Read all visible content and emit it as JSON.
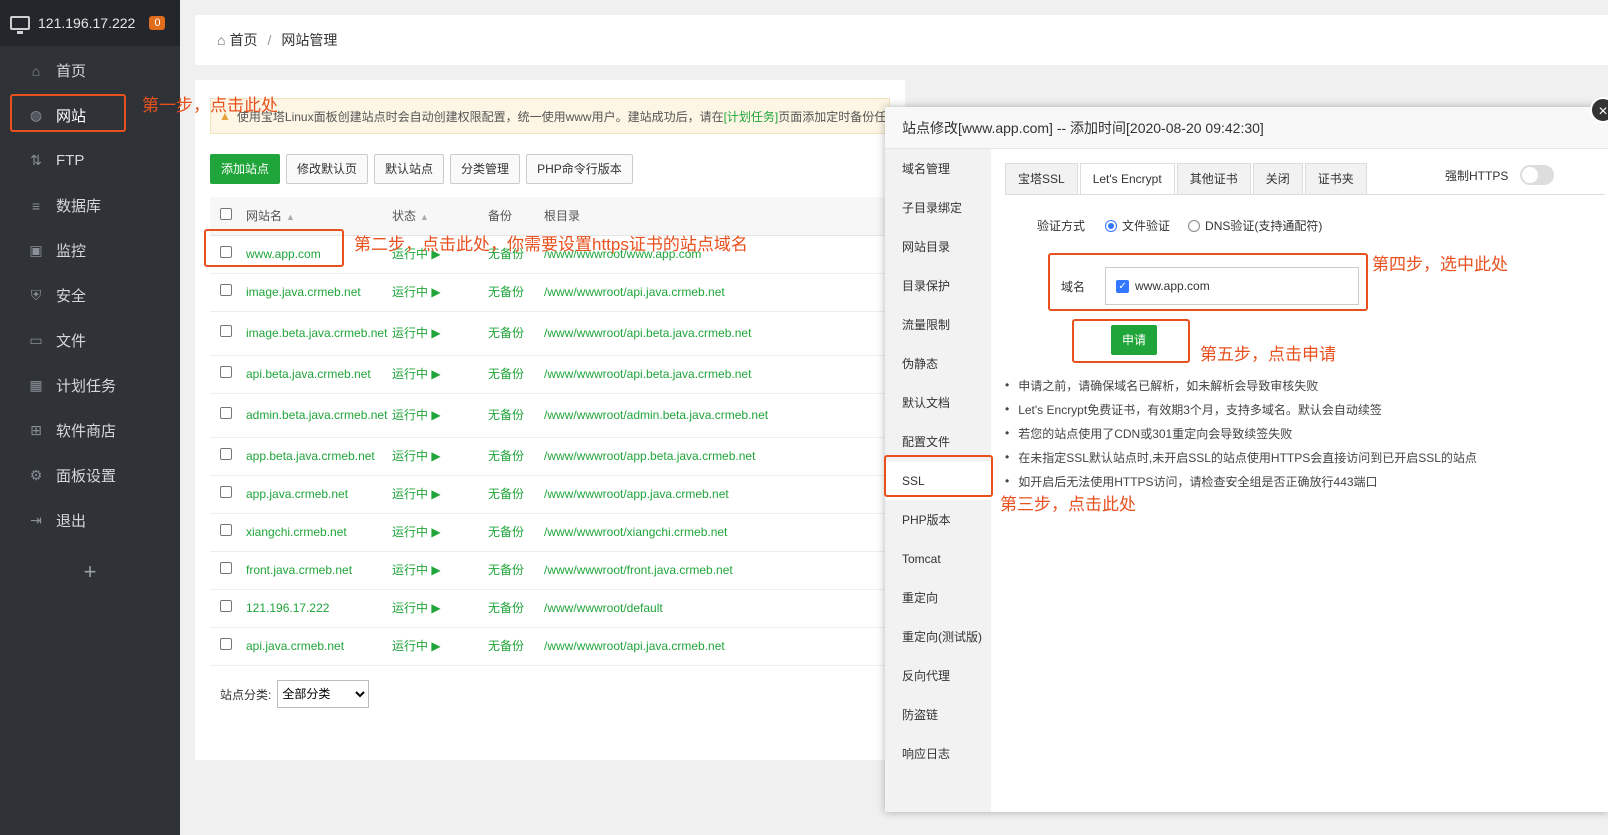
{
  "sidebar": {
    "server_ip": "121.196.17.222",
    "badge": "0",
    "items": [
      {
        "label": "首页",
        "icon": "home-icon"
      },
      {
        "label": "网站",
        "icon": "globe-icon"
      },
      {
        "label": "FTP",
        "icon": "ftp-icon"
      },
      {
        "label": "数据库",
        "icon": "database-icon"
      },
      {
        "label": "监控",
        "icon": "monitor-icon"
      },
      {
        "label": "安全",
        "icon": "shield-icon"
      },
      {
        "label": "文件",
        "icon": "folder-icon"
      },
      {
        "label": "计划任务",
        "icon": "calendar-icon"
      },
      {
        "label": "软件商店",
        "icon": "apps-icon"
      },
      {
        "label": "面板设置",
        "icon": "gear-icon"
      },
      {
        "label": "退出",
        "icon": "logout-icon"
      }
    ],
    "add": "+"
  },
  "breadcrumb": {
    "home": "首页",
    "sep": "/",
    "current": "网站管理"
  },
  "notice": {
    "text_a": "使用宝塔Linux面板创建站点时会自动创建权限配置，统一使用www用户。建站成功后，请在",
    "link": "[计划任务]",
    "text_b": "页面添加定时备份任务"
  },
  "toolbar": {
    "add_site": "添加站点",
    "edit_default_page": "修改默认页",
    "default_site": "默认站点",
    "category": "分类管理",
    "php_cli": "PHP命令行版本"
  },
  "table": {
    "headers": {
      "name": "网站名",
      "status": "状态",
      "backup": "备份",
      "root": "根目录"
    },
    "rows": [
      {
        "name": "www.app.com",
        "status": "运行中 ▶",
        "backup": "无备份",
        "root": "/www/wwwroot/www.app.com"
      },
      {
        "name": "image.java.crmeb.net",
        "status": "运行中 ▶",
        "backup": "无备份",
        "root": "/www/wwwroot/api.java.crmeb.net"
      },
      {
        "name": "image.beta.java.crmeb.net",
        "status": "运行中 ▶",
        "backup": "无备份",
        "root": "/www/wwwroot/api.beta.java.crmeb.net"
      },
      {
        "name": "api.beta.java.crmeb.net",
        "status": "运行中 ▶",
        "backup": "无备份",
        "root": "/www/wwwroot/api.beta.java.crmeb.net"
      },
      {
        "name": "admin.beta.java.crmeb.net",
        "status": "运行中 ▶",
        "backup": "无备份",
        "root": "/www/wwwroot/admin.beta.java.crmeb.net"
      },
      {
        "name": "app.beta.java.crmeb.net",
        "status": "运行中 ▶",
        "backup": "无备份",
        "root": "/www/wwwroot/app.beta.java.crmeb.net"
      },
      {
        "name": "app.java.crmeb.net",
        "status": "运行中 ▶",
        "backup": "无备份",
        "root": "/www/wwwroot/app.java.crmeb.net"
      },
      {
        "name": "xiangchi.crmeb.net",
        "status": "运行中 ▶",
        "backup": "无备份",
        "root": "/www/wwwroot/xiangchi.crmeb.net"
      },
      {
        "name": "front.java.crmeb.net",
        "status": "运行中 ▶",
        "backup": "无备份",
        "root": "/www/wwwroot/front.java.crmeb.net"
      },
      {
        "name": "121.196.17.222",
        "status": "运行中 ▶",
        "backup": "无备份",
        "root": "/www/wwwroot/default"
      },
      {
        "name": "api.java.crmeb.net",
        "status": "运行中 ▶",
        "backup": "无备份",
        "root": "/www/wwwroot/api.java.crmeb.net"
      }
    ]
  },
  "category": {
    "label": "站点分类:",
    "selected": "全部分类"
  },
  "modal": {
    "title": "站点修改[www.app.com] -- 添加时间[2020-08-20 09:42:30]",
    "close": "×",
    "menu": [
      "域名管理",
      "子目录绑定",
      "网站目录",
      "目录保护",
      "流量限制",
      "伪静态",
      "默认文档",
      "配置文件",
      "SSL",
      "PHP版本",
      "Tomcat",
      "重定向",
      "重定向(测试版)",
      "反向代理",
      "防盗链",
      "响应日志"
    ],
    "tabs": [
      "宝塔SSL",
      "Let's Encrypt",
      "其他证书",
      "关闭",
      "证书夹"
    ],
    "force_https": "强制HTTPS",
    "verify_label": "验证方式",
    "verify_file": "文件验证",
    "verify_dns": "DNS验证(支持通配符)",
    "domain_label": "域名",
    "domain_value": "www.app.com",
    "apply": "申请",
    "tips": [
      "申请之前，请确保域名已解析，如未解析会导致审核失败",
      "Let's Encrypt免费证书，有效期3个月，支持多域名。默认会自动续签",
      "若您的站点使用了CDN或301重定向会导致续签失败",
      "在未指定SSL默认站点时,未开启SSL的站点使用HTTPS会直接访问到已开启SSL的站点",
      "如开启后无法使用HTTPS访问，请检查安全组是否正确放行443端口"
    ]
  },
  "annotations": {
    "step1": "第一步，点击此处",
    "step2": "第二步，点击此处，你需要设置https证书的站点域名",
    "step3": "第三步，点击此处",
    "step4": "第四步，选中此处",
    "step5": "第五步，点击申请"
  },
  "colors": {
    "accent": "#20a53a",
    "annotation": "#e8501e",
    "sidebar": "#2f3338"
  }
}
